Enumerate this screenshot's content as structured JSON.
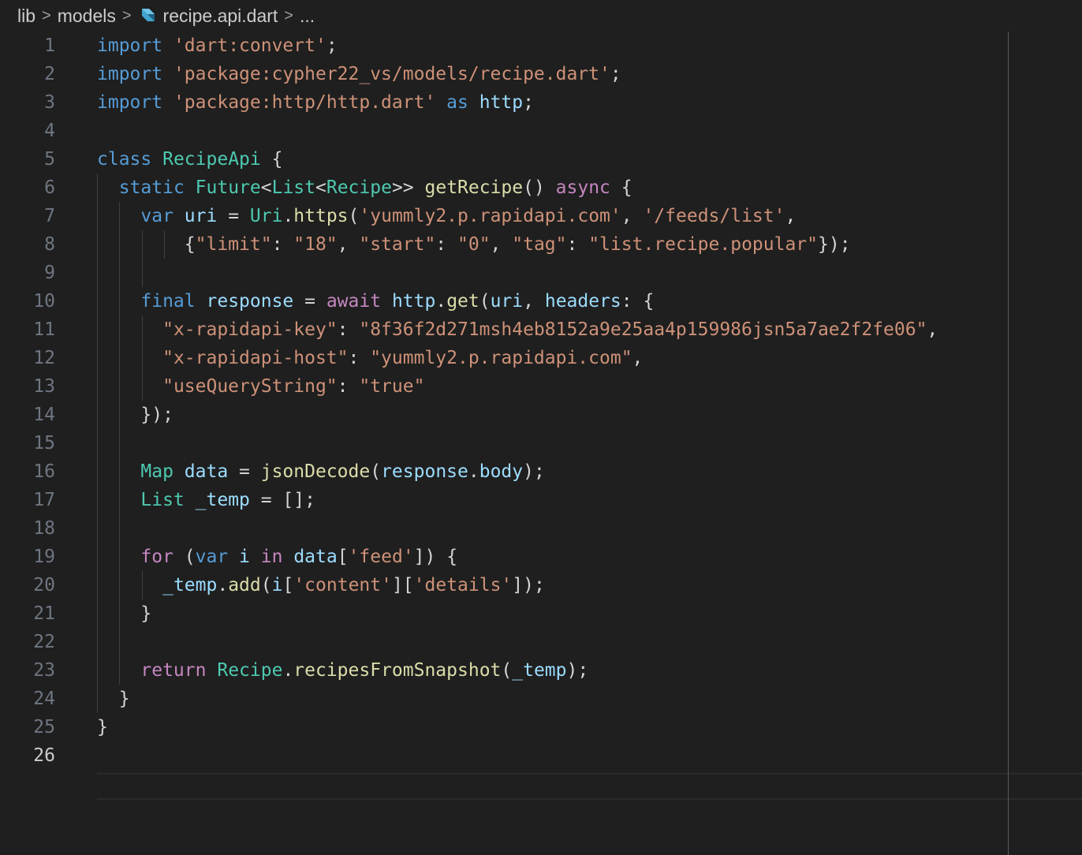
{
  "breadcrumb": {
    "items": [
      "lib",
      "models",
      "recipe.api.dart",
      "..."
    ],
    "separator": ">"
  },
  "editor": {
    "active_line": 26,
    "lines": [
      {
        "n": "1",
        "tokens": [
          [
            "k",
            "import"
          ],
          [
            "p",
            " "
          ],
          [
            "s",
            "'dart:convert'"
          ],
          [
            "p",
            ";"
          ]
        ]
      },
      {
        "n": "2",
        "tokens": [
          [
            "k",
            "import"
          ],
          [
            "p",
            " "
          ],
          [
            "s",
            "'package:cypher22_vs/models/recipe.dart'"
          ],
          [
            "p",
            ";"
          ]
        ]
      },
      {
        "n": "3",
        "tokens": [
          [
            "k",
            "import"
          ],
          [
            "p",
            " "
          ],
          [
            "s",
            "'package:http/http.dart'"
          ],
          [
            "p",
            " "
          ],
          [
            "k",
            "as"
          ],
          [
            "p",
            " "
          ],
          [
            "v",
            "http"
          ],
          [
            "p",
            ";"
          ]
        ]
      },
      {
        "n": "4",
        "tokens": []
      },
      {
        "n": "5",
        "tokens": [
          [
            "k",
            "class"
          ],
          [
            "p",
            " "
          ],
          [
            "t",
            "RecipeApi"
          ],
          [
            "p",
            " {"
          ]
        ]
      },
      {
        "n": "6",
        "tokens": [
          [
            "p",
            "  "
          ],
          [
            "k",
            "static"
          ],
          [
            "p",
            " "
          ],
          [
            "t",
            "Future"
          ],
          [
            "p",
            "<"
          ],
          [
            "t",
            "List"
          ],
          [
            "p",
            "<"
          ],
          [
            "t",
            "Recipe"
          ],
          [
            "p",
            ">> "
          ],
          [
            "f",
            "getRecipe"
          ],
          [
            "p",
            "() "
          ],
          [
            "c",
            "async"
          ],
          [
            "p",
            " {"
          ]
        ]
      },
      {
        "n": "7",
        "tokens": [
          [
            "p",
            "    "
          ],
          [
            "k",
            "var"
          ],
          [
            "p",
            " "
          ],
          [
            "v",
            "uri"
          ],
          [
            "p",
            " = "
          ],
          [
            "t",
            "Uri"
          ],
          [
            "p",
            "."
          ],
          [
            "f",
            "https"
          ],
          [
            "p",
            "("
          ],
          [
            "s",
            "'yummly2.p.rapidapi.com'"
          ],
          [
            "p",
            ", "
          ],
          [
            "s",
            "'/feeds/list'"
          ],
          [
            "p",
            ","
          ]
        ]
      },
      {
        "n": "8",
        "tokens": [
          [
            "p",
            "        {"
          ],
          [
            "s",
            "\"limit\""
          ],
          [
            "p",
            ": "
          ],
          [
            "s",
            "\"18\""
          ],
          [
            "p",
            ", "
          ],
          [
            "s",
            "\"start\""
          ],
          [
            "p",
            ": "
          ],
          [
            "s",
            "\"0\""
          ],
          [
            "p",
            ", "
          ],
          [
            "s",
            "\"tag\""
          ],
          [
            "p",
            ": "
          ],
          [
            "s",
            "\"list.recipe.popular\""
          ],
          [
            "p",
            "});"
          ]
        ]
      },
      {
        "n": "9",
        "tokens": []
      },
      {
        "n": "10",
        "tokens": [
          [
            "p",
            "    "
          ],
          [
            "k",
            "final"
          ],
          [
            "p",
            " "
          ],
          [
            "v",
            "response"
          ],
          [
            "p",
            " = "
          ],
          [
            "c",
            "await"
          ],
          [
            "p",
            " "
          ],
          [
            "v",
            "http"
          ],
          [
            "p",
            "."
          ],
          [
            "f",
            "get"
          ],
          [
            "p",
            "("
          ],
          [
            "v",
            "uri"
          ],
          [
            "p",
            ", "
          ],
          [
            "v",
            "headers"
          ],
          [
            "p",
            ": {"
          ]
        ]
      },
      {
        "n": "11",
        "tokens": [
          [
            "p",
            "      "
          ],
          [
            "s",
            "\"x-rapidapi-key\""
          ],
          [
            "p",
            ": "
          ],
          [
            "s",
            "\"8f36f2d271msh4eb8152a9e25aa4p159986jsn5a7ae2f2fe06\""
          ],
          [
            "p",
            ","
          ]
        ]
      },
      {
        "n": "12",
        "tokens": [
          [
            "p",
            "      "
          ],
          [
            "s",
            "\"x-rapidapi-host\""
          ],
          [
            "p",
            ": "
          ],
          [
            "s",
            "\"yummly2.p.rapidapi.com\""
          ],
          [
            "p",
            ","
          ]
        ]
      },
      {
        "n": "13",
        "tokens": [
          [
            "p",
            "      "
          ],
          [
            "s",
            "\"useQueryString\""
          ],
          [
            "p",
            ": "
          ],
          [
            "s",
            "\"true\""
          ]
        ]
      },
      {
        "n": "14",
        "tokens": [
          [
            "p",
            "    });"
          ]
        ]
      },
      {
        "n": "15",
        "tokens": []
      },
      {
        "n": "16",
        "tokens": [
          [
            "p",
            "    "
          ],
          [
            "t",
            "Map"
          ],
          [
            "p",
            " "
          ],
          [
            "v",
            "data"
          ],
          [
            "p",
            " = "
          ],
          [
            "f",
            "jsonDecode"
          ],
          [
            "p",
            "("
          ],
          [
            "v",
            "response"
          ],
          [
            "p",
            "."
          ],
          [
            "v",
            "body"
          ],
          [
            "p",
            ");"
          ]
        ]
      },
      {
        "n": "17",
        "tokens": [
          [
            "p",
            "    "
          ],
          [
            "t",
            "List"
          ],
          [
            "p",
            " "
          ],
          [
            "v",
            "_temp"
          ],
          [
            "p",
            " = [];"
          ]
        ]
      },
      {
        "n": "18",
        "tokens": []
      },
      {
        "n": "19",
        "tokens": [
          [
            "p",
            "    "
          ],
          [
            "c",
            "for"
          ],
          [
            "p",
            " ("
          ],
          [
            "k",
            "var"
          ],
          [
            "p",
            " "
          ],
          [
            "v",
            "i"
          ],
          [
            "p",
            " "
          ],
          [
            "c",
            "in"
          ],
          [
            "p",
            " "
          ],
          [
            "v",
            "data"
          ],
          [
            "p",
            "["
          ],
          [
            "s",
            "'feed'"
          ],
          [
            "p",
            "]) {"
          ]
        ]
      },
      {
        "n": "20",
        "tokens": [
          [
            "p",
            "      "
          ],
          [
            "v",
            "_temp"
          ],
          [
            "p",
            "."
          ],
          [
            "f",
            "add"
          ],
          [
            "p",
            "("
          ],
          [
            "v",
            "i"
          ],
          [
            "p",
            "["
          ],
          [
            "s",
            "'content'"
          ],
          [
            "p",
            "]["
          ],
          [
            "s",
            "'details'"
          ],
          [
            "p",
            "]);"
          ]
        ]
      },
      {
        "n": "21",
        "tokens": [
          [
            "p",
            "    }"
          ]
        ]
      },
      {
        "n": "22",
        "tokens": []
      },
      {
        "n": "23",
        "tokens": [
          [
            "p",
            "    "
          ],
          [
            "c",
            "return"
          ],
          [
            "p",
            " "
          ],
          [
            "t",
            "Recipe"
          ],
          [
            "p",
            "."
          ],
          [
            "f",
            "recipesFromSnapshot"
          ],
          [
            "p",
            "("
          ],
          [
            "v",
            "_temp"
          ],
          [
            "p",
            ");"
          ]
        ]
      },
      {
        "n": "24",
        "tokens": [
          [
            "p",
            "  }"
          ]
        ]
      },
      {
        "n": "25",
        "tokens": [
          [
            "p",
            "}"
          ]
        ]
      },
      {
        "n": "26",
        "tokens": []
      }
    ]
  }
}
